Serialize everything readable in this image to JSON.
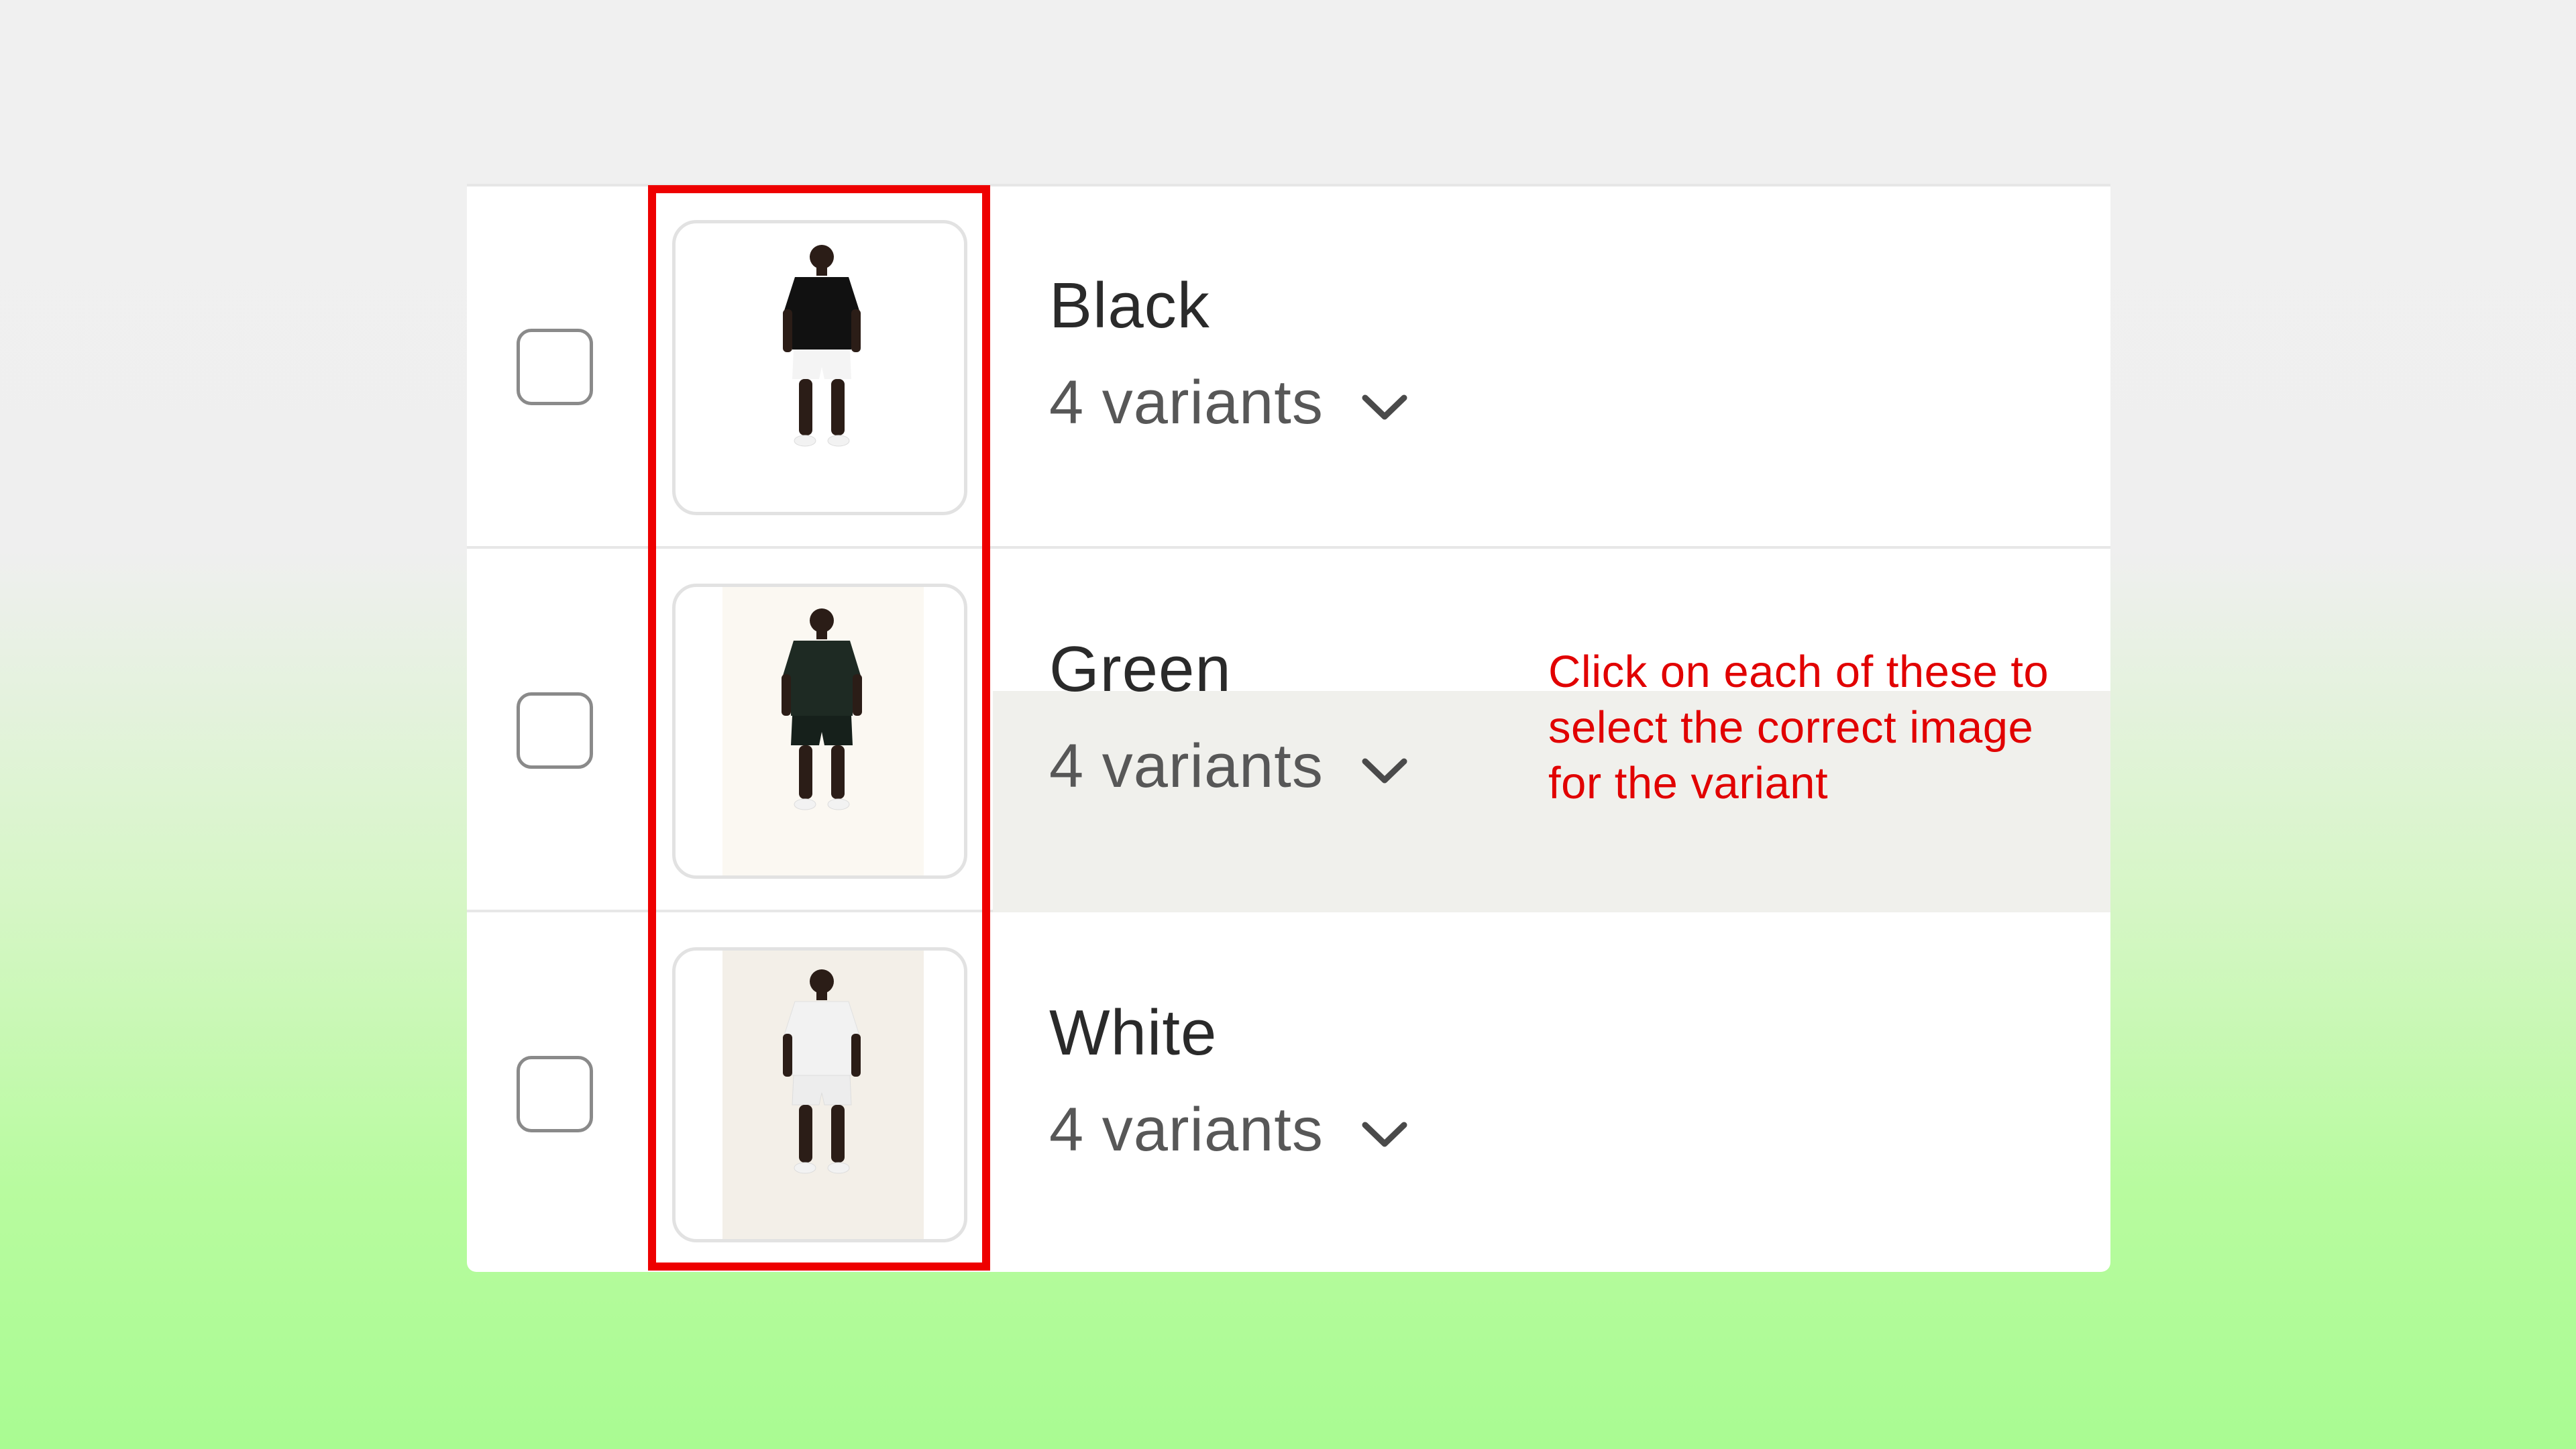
{
  "colors": {
    "annotation_red": "#e10000",
    "highlight_border": "#ee0000",
    "hover_row_bg": "#f0f0ec"
  },
  "rows": [
    {
      "title": "Black",
      "variants_label": "4 variants",
      "thumbnail": {
        "shirt": "#111111",
        "shorts": "#f4f4f4"
      },
      "checked": false
    },
    {
      "title": "Green",
      "variants_label": "4 variants",
      "thumbnail": {
        "shirt": "#1e2a23",
        "shorts": "#16201b"
      },
      "checked": false
    },
    {
      "title": "White",
      "variants_label": "4 variants",
      "thumbnail": {
        "shirt": "#f2f2f2",
        "shorts": "#ededed"
      },
      "checked": false
    }
  ],
  "annotation": {
    "text": "Click on each of these to select the correct image for the variant"
  },
  "icons": {
    "chevron": "chevron-down-icon"
  }
}
